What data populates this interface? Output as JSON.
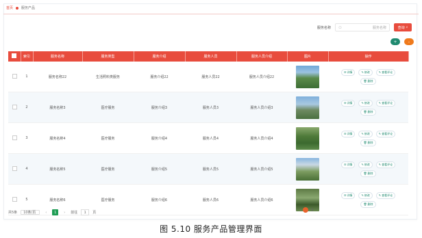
{
  "breadcrumb": {
    "home": "首页",
    "current": "服务产品"
  },
  "search": {
    "label": "服务名称",
    "placeholder": "服务名称",
    "button": "查询"
  },
  "toolbar": {
    "add": "+",
    "del": "-"
  },
  "table": {
    "headers": [
      "",
      "索引",
      "服务名称",
      "服务类型",
      "服务介绍",
      "服务人员",
      "服务人员介绍",
      "图片",
      "操作"
    ],
    "rows": [
      {
        "index": "1",
        "name": "服务名称22",
        "type": "生活照料类服务",
        "intro": "服务介绍22",
        "staff": "服务人员22",
        "staff_intro": "服务人员介绍22"
      },
      {
        "index": "2",
        "name": "服务名称3",
        "type": "医疗服务",
        "intro": "服务介绍3",
        "staff": "服务人员3",
        "staff_intro": "服务人员介绍3"
      },
      {
        "index": "3",
        "name": "服务名称4",
        "type": "医疗服务",
        "intro": "服务介绍4",
        "staff": "服务人员4",
        "staff_intro": "服务人员介绍4"
      },
      {
        "index": "4",
        "name": "服务名称5",
        "type": "医疗服务",
        "intro": "服务介绍5",
        "staff": "服务人员5",
        "staff_intro": "服务人员介绍5"
      },
      {
        "index": "5",
        "name": "服务名称6",
        "type": "医疗服务",
        "intro": "服务介绍6",
        "staff": "服务人员6",
        "staff_intro": "服务人员介绍6"
      }
    ],
    "ops": {
      "detail": "详情",
      "edit": "修改",
      "review": "查看评论",
      "delete": "删除"
    }
  },
  "pager": {
    "total": "共5条",
    "size": "10条/页",
    "prev": "‹",
    "current": "1",
    "next": "›",
    "goto": "前往",
    "page": "1",
    "unit": "页"
  },
  "caption": "图 5.10    服务产品管理界面",
  "colors": {
    "accent": "#e84c3d",
    "green": "#1f8a70",
    "orange": "#ef7a1c"
  },
  "icons": {
    "search": "search-icon",
    "edit": "pencil-icon",
    "detail": "list-icon",
    "delete": "trash-icon"
  }
}
